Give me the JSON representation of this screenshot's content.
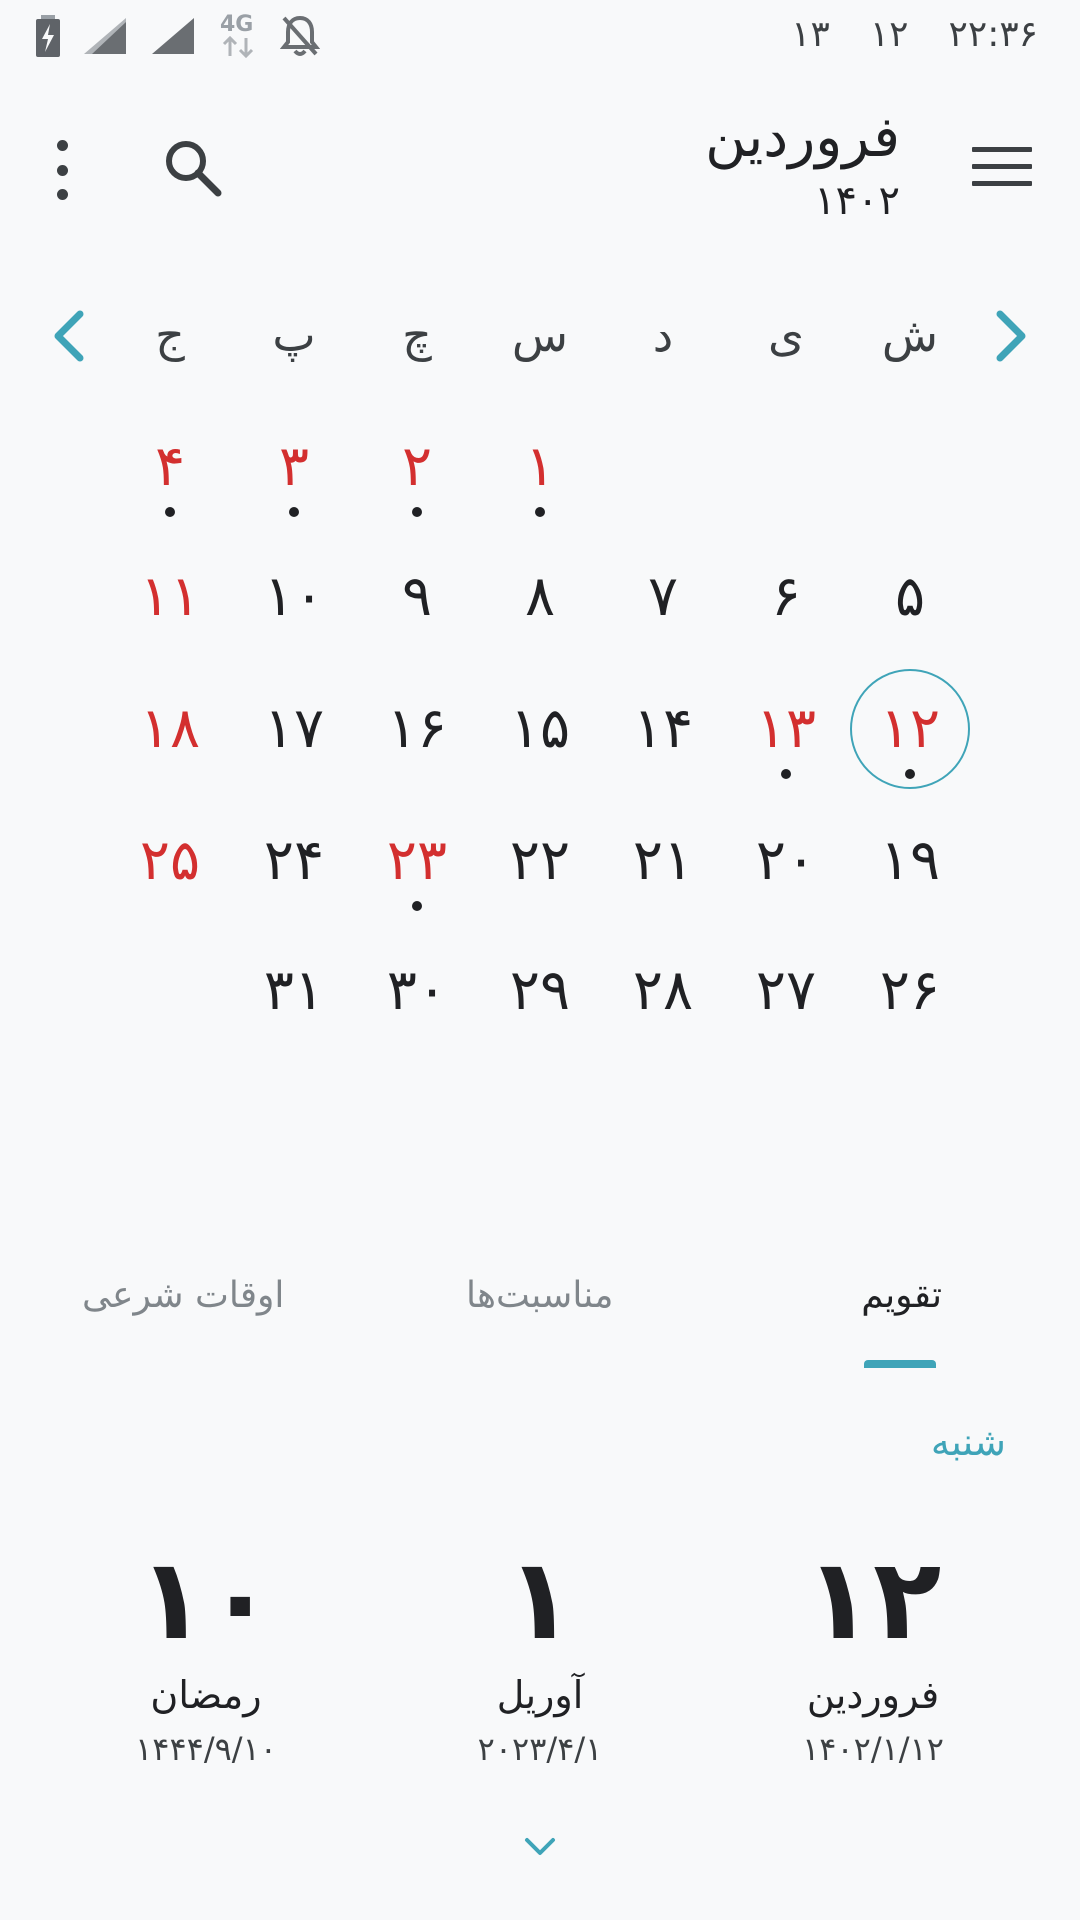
{
  "status_bar": {
    "times": [
      "۲۲:۳۶",
      "۱۲",
      "۱۳"
    ],
    "network_label": "4G",
    "icons": [
      "battery-charging-icon",
      "signal-icon",
      "signal-icon",
      "network-4g-icon",
      "notifications-off-icon"
    ]
  },
  "toolbar": {
    "month": "فروردین",
    "year": "۱۴۰۲",
    "icons": [
      "menu-icon",
      "search-icon",
      "more-vert-icon"
    ]
  },
  "calendar": {
    "weekdays": [
      "ش",
      "ی",
      "د",
      "س",
      "چ",
      "پ",
      "ج"
    ],
    "weeks": [
      [
        null,
        null,
        null,
        "۱",
        "۲",
        "۳",
        "۴"
      ],
      [
        "۵",
        "۶",
        "۷",
        "۸",
        "۹",
        "۱۰",
        "۱۱"
      ],
      [
        "۱۲",
        "۱۳",
        "۱۴",
        "۱۵",
        "۱۶",
        "۱۷",
        "۱۸"
      ],
      [
        "۱۹",
        "۲۰",
        "۲۱",
        "۲۲",
        "۲۳",
        "۲۴",
        "۲۵"
      ],
      [
        "۲۶",
        "۲۷",
        "۲۸",
        "۲۹",
        "۳۰",
        "۳۱",
        null
      ]
    ],
    "holidays": [
      "۱",
      "۲",
      "۳",
      "۴",
      "۱۱",
      "۱۲",
      "۱۳",
      "۱۸",
      "۲۳",
      "۲۵"
    ],
    "event_dots": [
      "۱",
      "۲",
      "۳",
      "۴",
      "۱۲",
      "۱۳",
      "۲۳"
    ],
    "today": "۱۲",
    "colors": {
      "holiday": "#d32f2f",
      "accent": "#3fa4b8",
      "text": "#202124"
    }
  },
  "tabs": [
    {
      "label": "تقویم",
      "active": true
    },
    {
      "label": "مناسبت‌ها",
      "active": false
    },
    {
      "label": "اوقات شرعی",
      "active": false
    }
  ],
  "day_info": {
    "weekday": "شنبه",
    "persian": {
      "day": "۱۲",
      "month": "فروردین",
      "full": "۱۴۰۲/۱/۱۲"
    },
    "gregorian": {
      "day": "۱",
      "month": "آوریل",
      "full": "۲۰۲۳/۴/۱"
    },
    "hijri": {
      "day": "۱۰",
      "month": "رمضان",
      "full": "۱۴۴۴/۹/۱۰"
    }
  }
}
